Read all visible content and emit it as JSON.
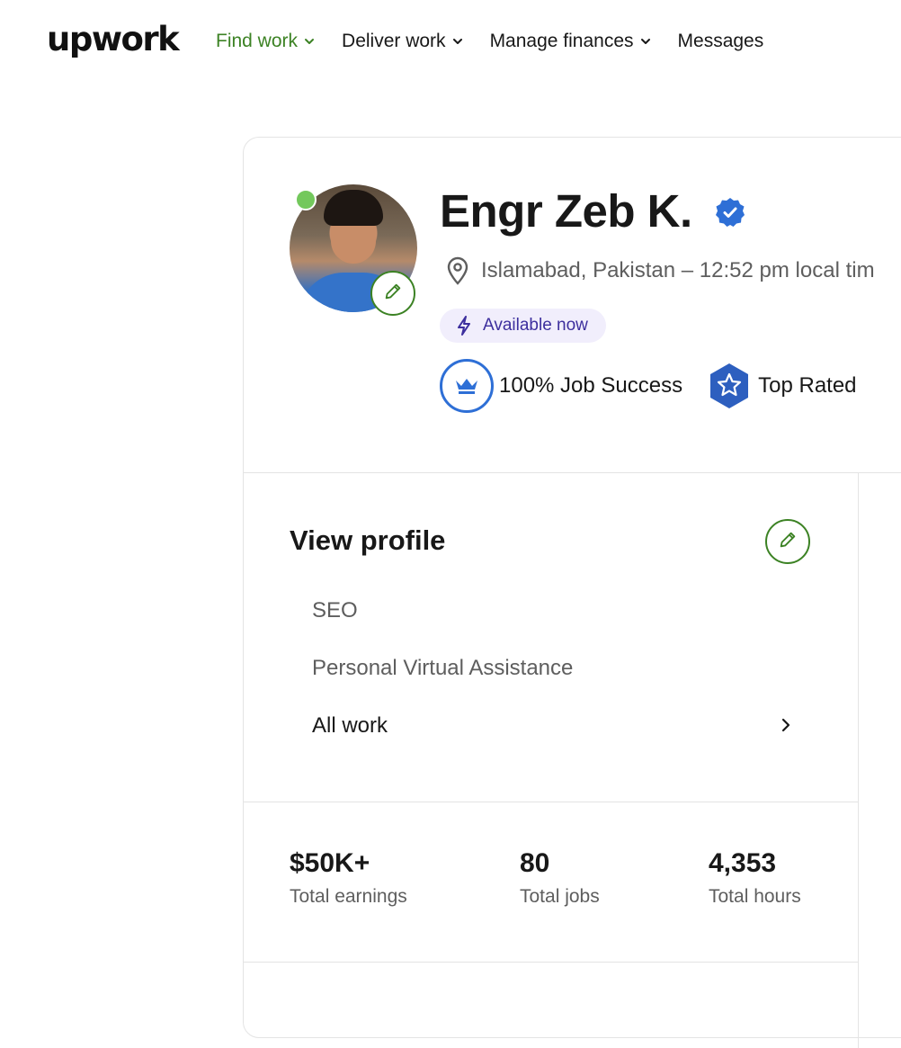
{
  "header": {
    "logo": "upwork",
    "nav": [
      {
        "label": "Find work",
        "active": true,
        "dropdown": true
      },
      {
        "label": "Deliver work",
        "active": false,
        "dropdown": true
      },
      {
        "label": "Manage finances",
        "active": false,
        "dropdown": true
      },
      {
        "label": "Messages",
        "active": false,
        "dropdown": false
      }
    ]
  },
  "profile": {
    "name": "Engr Zeb K.",
    "location": "Islamabad, Pakistan – 12:52 pm local tim",
    "availability": "Available now",
    "job_success": "100% Job Success",
    "top_rated": "Top Rated",
    "online": true,
    "verified": true
  },
  "view_profile": {
    "title": "View profile",
    "items": [
      "SEO",
      "Personal Virtual Assistance"
    ],
    "all_work": "All work"
  },
  "stats": [
    {
      "value": "$50K+",
      "label": "Total earnings"
    },
    {
      "value": "80",
      "label": "Total jobs"
    },
    {
      "value": "4,353",
      "label": "Total hours"
    }
  ],
  "colors": {
    "brand_green": "#3c8224",
    "badge_blue": "#2e6fd6",
    "available_bg": "#f1eefc",
    "available_text": "#3d2f9e",
    "online_green": "#73c85c"
  },
  "icons": {
    "verified": "verified-badge-icon",
    "location": "location-pin-icon",
    "availability": "lightning-bolt-icon",
    "job_success": "crown-icon",
    "top_rated": "star-hexagon-icon",
    "edit": "pencil-icon",
    "all_work": "chevron-right-icon"
  }
}
